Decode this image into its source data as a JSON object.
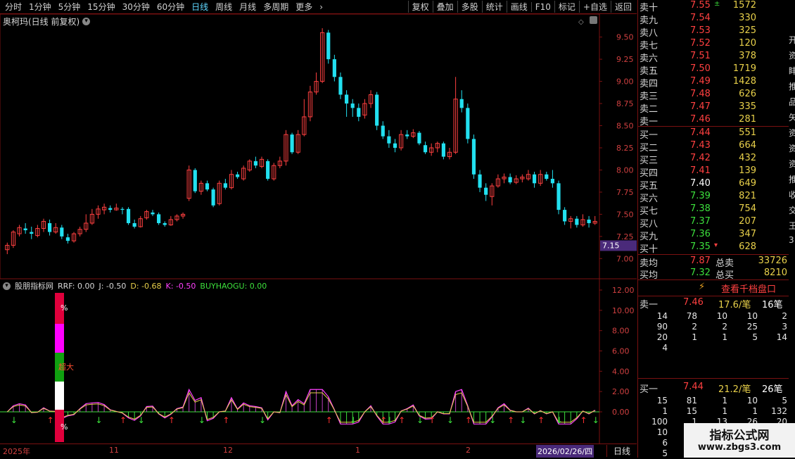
{
  "toolbar": {
    "left_items": [
      {
        "label": "分时",
        "active": false
      },
      {
        "label": "1分钟",
        "active": false
      },
      {
        "label": "5分钟",
        "active": false
      },
      {
        "label": "15分钟",
        "active": false
      },
      {
        "label": "30分钟",
        "active": false
      },
      {
        "label": "60分钟",
        "active": false
      },
      {
        "label": "日线",
        "active": true
      },
      {
        "label": "周线",
        "active": false
      },
      {
        "label": "月线",
        "active": false
      },
      {
        "label": "多周期",
        "active": false
      },
      {
        "label": "更多",
        "active": false
      }
    ],
    "right_items": [
      "复权",
      "叠加",
      "多股",
      "统计",
      "画线",
      "F10",
      "标记",
      "+自选",
      "返回"
    ]
  },
  "stock": {
    "title": "奥柯玛(日线 前复权)"
  },
  "main_chart": {
    "y_ticks": [
      "9.50",
      "9.25",
      "9.00",
      "8.75",
      "8.50",
      "8.25",
      "8.00",
      "7.75",
      "7.50",
      "7.25",
      "7.00"
    ],
    "current_price": "7.15"
  },
  "indicator": {
    "name": "股朋指标网",
    "values": [
      {
        "text": "RRF: 0.00",
        "color": "#d8d8d8"
      },
      {
        "text": "J: -0.50",
        "color": "#d8d8d8"
      },
      {
        "text": "D: -0.68",
        "color": "#e8d04a"
      },
      {
        "text": "K: -0.50",
        "color": "#ff40ff"
      },
      {
        "text": "BUYHAOGU: 0.00",
        "color": "#3ce03c"
      }
    ],
    "y_ticks": [
      "12.00",
      "10.00",
      "8.00",
      "6.00",
      "4.00",
      "2.00",
      "0.00"
    ],
    "bar_labels": {
      "top": "%",
      "mid": "超大",
      "bottom": "%"
    }
  },
  "chart_data": {
    "type": "candlestick",
    "ylim": [
      6.78,
      9.68
    ],
    "candles": [
      [
        7.1,
        7.15,
        7.18,
        7.05
      ],
      [
        7.15,
        7.3,
        7.32,
        7.12
      ],
      [
        7.28,
        7.35,
        7.38,
        7.25
      ],
      [
        7.34,
        7.32,
        7.4,
        7.28
      ],
      [
        7.3,
        7.28,
        7.36,
        7.22
      ],
      [
        7.26,
        7.34,
        7.38,
        7.24
      ],
      [
        7.34,
        7.42,
        7.45,
        7.3
      ],
      [
        7.4,
        7.3,
        7.44,
        7.26
      ],
      [
        7.3,
        7.35,
        7.4,
        7.28
      ],
      [
        7.35,
        7.25,
        7.38,
        7.22
      ],
      [
        7.24,
        7.2,
        7.28,
        7.17
      ],
      [
        7.2,
        7.28,
        7.3,
        7.18
      ],
      [
        7.28,
        7.33,
        7.36,
        7.25
      ],
      [
        7.33,
        7.4,
        7.5,
        7.3
      ],
      [
        7.4,
        7.5,
        7.56,
        7.38
      ],
      [
        7.5,
        7.56,
        7.6,
        7.45
      ],
      [
        7.55,
        7.58,
        7.62,
        7.5
      ],
      [
        7.57,
        7.55,
        7.6,
        7.52
      ],
      [
        7.55,
        7.57,
        7.62,
        7.54
      ],
      [
        7.56,
        7.55,
        7.58,
        7.5
      ],
      [
        7.56,
        7.4,
        7.58,
        7.38
      ],
      [
        7.4,
        7.36,
        7.44,
        7.34
      ],
      [
        7.36,
        7.45,
        7.48,
        7.35
      ],
      [
        7.46,
        7.53,
        7.55,
        7.44
      ],
      [
        7.52,
        7.5,
        7.55,
        7.48
      ],
      [
        7.5,
        7.4,
        7.52,
        7.38
      ],
      [
        7.4,
        7.38,
        7.42,
        7.36
      ],
      [
        7.38,
        7.44,
        7.48,
        7.37
      ],
      [
        7.44,
        7.48,
        7.5,
        7.42
      ],
      [
        7.48,
        7.5,
        7.52,
        7.45
      ],
      [
        7.68,
        8.0,
        8.05,
        7.65
      ],
      [
        8.0,
        7.76,
        8.02,
        7.74
      ],
      [
        7.76,
        7.85,
        7.88,
        7.72
      ],
      [
        7.85,
        7.78,
        7.88,
        7.76
      ],
      [
        7.78,
        7.6,
        7.8,
        7.58
      ],
      [
        7.62,
        7.85,
        7.88,
        7.6
      ],
      [
        7.85,
        7.8,
        7.9,
        7.78
      ],
      [
        7.8,
        7.95,
        8.0,
        7.78
      ],
      [
        7.95,
        7.92,
        7.98,
        7.9
      ],
      [
        7.9,
        8.02,
        8.05,
        7.88
      ],
      [
        8.0,
        8.1,
        8.12,
        7.98
      ],
      [
        8.1,
        8.05,
        8.15,
        8.02
      ],
      [
        8.04,
        8.12,
        8.15,
        8.02
      ],
      [
        8.1,
        7.9,
        8.12,
        7.88
      ],
      [
        7.9,
        8.05,
        8.08,
        7.88
      ],
      [
        8.05,
        8.1,
        8.15,
        8.02
      ],
      [
        8.1,
        8.4,
        8.45,
        8.05
      ],
      [
        8.4,
        8.2,
        8.42,
        8.18
      ],
      [
        8.2,
        8.4,
        8.45,
        8.18
      ],
      [
        8.4,
        8.6,
        8.8,
        8.38
      ],
      [
        8.6,
        8.88,
        8.95,
        8.55
      ],
      [
        8.88,
        9.0,
        9.1,
        8.85
      ],
      [
        9.0,
        9.55,
        9.6,
        8.98
      ],
      [
        9.55,
        9.25,
        9.58,
        9.2
      ],
      [
        9.25,
        9.05,
        9.3,
        9.0
      ],
      [
        9.05,
        8.85,
        9.1,
        8.8
      ],
      [
        8.85,
        8.75,
        8.9,
        8.6
      ],
      [
        8.75,
        8.7,
        8.8,
        8.6
      ],
      [
        8.7,
        8.6,
        8.75,
        8.55
      ],
      [
        8.62,
        8.75,
        8.8,
        8.58
      ],
      [
        8.75,
        8.85,
        8.9,
        8.7
      ],
      [
        8.85,
        8.5,
        8.88,
        8.45
      ],
      [
        8.5,
        8.38,
        8.55,
        8.35
      ],
      [
        8.38,
        8.3,
        8.45,
        8.25
      ],
      [
        8.3,
        8.25,
        8.35,
        8.2
      ],
      [
        8.25,
        8.4,
        8.45,
        8.22
      ],
      [
        8.4,
        8.38,
        8.45,
        8.35
      ],
      [
        8.38,
        8.42,
        8.46,
        8.36
      ],
      [
        8.42,
        8.3,
        8.44,
        8.28
      ],
      [
        8.28,
        8.2,
        8.32,
        8.18
      ],
      [
        8.2,
        8.25,
        8.3,
        8.16
      ],
      [
        8.25,
        8.3,
        8.32,
        8.2
      ],
      [
        8.3,
        8.15,
        8.32,
        8.12
      ],
      [
        8.15,
        8.2,
        8.25,
        8.12
      ],
      [
        8.2,
        8.8,
        9.05,
        8.18
      ],
      [
        8.8,
        8.7,
        8.9,
        8.65
      ],
      [
        8.7,
        8.35,
        8.75,
        8.3
      ],
      [
        8.35,
        7.95,
        8.4,
        7.9
      ],
      [
        7.95,
        7.8,
        8.0,
        7.75
      ],
      [
        7.8,
        7.72,
        7.85,
        7.65
      ],
      [
        7.7,
        7.82,
        7.85,
        7.6
      ],
      [
        7.82,
        7.9,
        7.95,
        7.8
      ],
      [
        7.9,
        7.92,
        7.96,
        7.85
      ],
      [
        7.92,
        7.86,
        7.96,
        7.84
      ],
      [
        7.86,
        7.9,
        7.94,
        7.84
      ],
      [
        7.9,
        7.92,
        7.95,
        7.86
      ],
      [
        7.9,
        7.95,
        8.0,
        7.88
      ],
      [
        7.95,
        7.85,
        7.98,
        7.8
      ],
      [
        7.85,
        7.95,
        8.0,
        7.82
      ],
      [
        7.95,
        7.9,
        7.98,
        7.88
      ],
      [
        7.9,
        7.85,
        8.0,
        7.8
      ],
      [
        7.85,
        7.55,
        7.88,
        7.5
      ],
      [
        7.55,
        7.42,
        7.58,
        7.38
      ],
      [
        7.42,
        7.45,
        7.48,
        7.34
      ],
      [
        7.45,
        7.38,
        7.48,
        7.35
      ],
      [
        7.38,
        7.44,
        7.5,
        7.36
      ],
      [
        7.44,
        7.4,
        7.48,
        7.35
      ],
      [
        7.4,
        7.42,
        7.48,
        7.38
      ]
    ]
  },
  "order_book": {
    "sell": [
      {
        "label": "卖十",
        "price": "7.55",
        "vol": "1572",
        "mark": "±"
      },
      {
        "label": "卖九",
        "price": "7.54",
        "vol": "330"
      },
      {
        "label": "卖八",
        "price": "7.53",
        "vol": "325"
      },
      {
        "label": "卖七",
        "price": "7.52",
        "vol": "120"
      },
      {
        "label": "卖六",
        "price": "7.51",
        "vol": "378"
      },
      {
        "label": "卖五",
        "price": "7.50",
        "vol": "1719"
      },
      {
        "label": "卖四",
        "price": "7.49",
        "vol": "1428"
      },
      {
        "label": "卖三",
        "price": "7.48",
        "vol": "626"
      },
      {
        "label": "卖二",
        "price": "7.47",
        "vol": "335"
      },
      {
        "label": "卖一",
        "price": "7.46",
        "vol": "281"
      }
    ],
    "buy": [
      {
        "label": "买一",
        "price": "7.44",
        "vol": "551",
        "color": "red"
      },
      {
        "label": "买二",
        "price": "7.43",
        "vol": "664",
        "color": "red"
      },
      {
        "label": "买三",
        "price": "7.42",
        "vol": "432",
        "color": "red"
      },
      {
        "label": "买四",
        "price": "7.41",
        "vol": "139",
        "color": "red"
      },
      {
        "label": "买五",
        "price": "7.40",
        "vol": "649",
        "color": "white"
      },
      {
        "label": "买六",
        "price": "7.39",
        "vol": "821",
        "color": "green"
      },
      {
        "label": "买七",
        "price": "7.38",
        "vol": "754",
        "color": "green"
      },
      {
        "label": "买八",
        "price": "7.37",
        "vol": "207",
        "color": "green"
      },
      {
        "label": "买九",
        "price": "7.36",
        "vol": "347",
        "color": "green"
      },
      {
        "label": "买十",
        "price": "7.35",
        "vol": "628",
        "color": "green",
        "mark": "▾"
      }
    ],
    "summary": [
      {
        "label": "卖均",
        "price": "7.87",
        "price_color": "red",
        "label2": "总卖",
        "total": "33726"
      },
      {
        "label": "买均",
        "price": "7.32",
        "price_color": "green",
        "label2": "总买",
        "total": "8210"
      }
    ]
  },
  "qianpan": {
    "icon": "lightning-icon",
    "label": "查看千档盘口"
  },
  "detail_sell": {
    "label": "卖一",
    "price": "7.46",
    "per": "17.6/笔",
    "count": "16笔",
    "rows": [
      [
        "14",
        "78",
        "10",
        "10",
        "2"
      ],
      [
        "90",
        "2",
        "2",
        "25",
        "3"
      ],
      [
        "20",
        "1",
        "1",
        "5",
        "14"
      ],
      [
        "4",
        "",
        "",
        "",
        ""
      ]
    ]
  },
  "detail_buy": {
    "label": "买一",
    "price": "7.44",
    "per": "21.2/笔",
    "count": "26笔",
    "rows": [
      [
        "15",
        "81",
        "1",
        "10",
        "5"
      ],
      [
        "1",
        "15",
        "1",
        "1",
        "132"
      ],
      [
        "100",
        "1",
        "13",
        "26",
        "20"
      ],
      [
        "10",
        "5",
        "1",
        "",
        ""
      ],
      [
        "6",
        "",
        "",
        "",
        ""
      ],
      [
        "5",
        "",
        "",
        "",
        ""
      ]
    ]
  },
  "time_axis": {
    "labels": [
      "2025年",
      "11",
      "12",
      "1",
      "2"
    ],
    "current_date": "2026/02/26/四",
    "period": "日线"
  },
  "far_right": {
    "chars": [
      "开",
      "资",
      "盽",
      "推",
      "品",
      "矢",
      "资",
      "资",
      "资",
      "推",
      "收",
      "交",
      "王",
      "3"
    ]
  },
  "watermark": {
    "line1": "指标公式网",
    "line2": "www.zbgs3.com"
  },
  "colors": {
    "up": "#ff4040",
    "down": "#22e0f0",
    "frame": "#7a1111",
    "grid": "#3a0000"
  }
}
